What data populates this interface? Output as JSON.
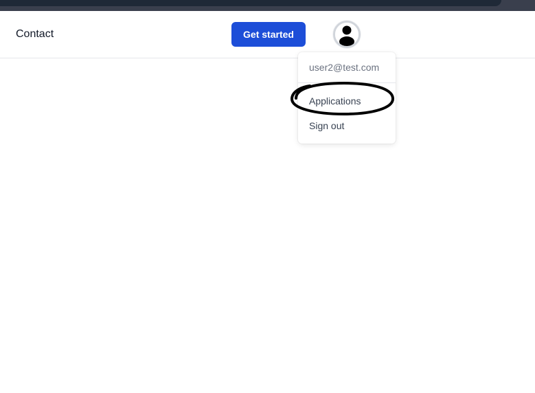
{
  "header": {
    "nav": {
      "contact_label": "Contact"
    },
    "cta": {
      "get_started_label": "Get started"
    },
    "avatar": {
      "icon": "user-avatar-icon"
    }
  },
  "user_menu": {
    "email": "user2@test.com",
    "items": [
      {
        "label": "Applications",
        "highlighted": true
      },
      {
        "label": "Sign out",
        "highlighted": false
      }
    ]
  },
  "colors": {
    "primary": "#1d4ed8",
    "text_dark": "#111827",
    "text_muted": "#6b7280",
    "border": "#e5e7eb",
    "top_strip": "#1f2937",
    "highlight_stroke": "#000000"
  }
}
